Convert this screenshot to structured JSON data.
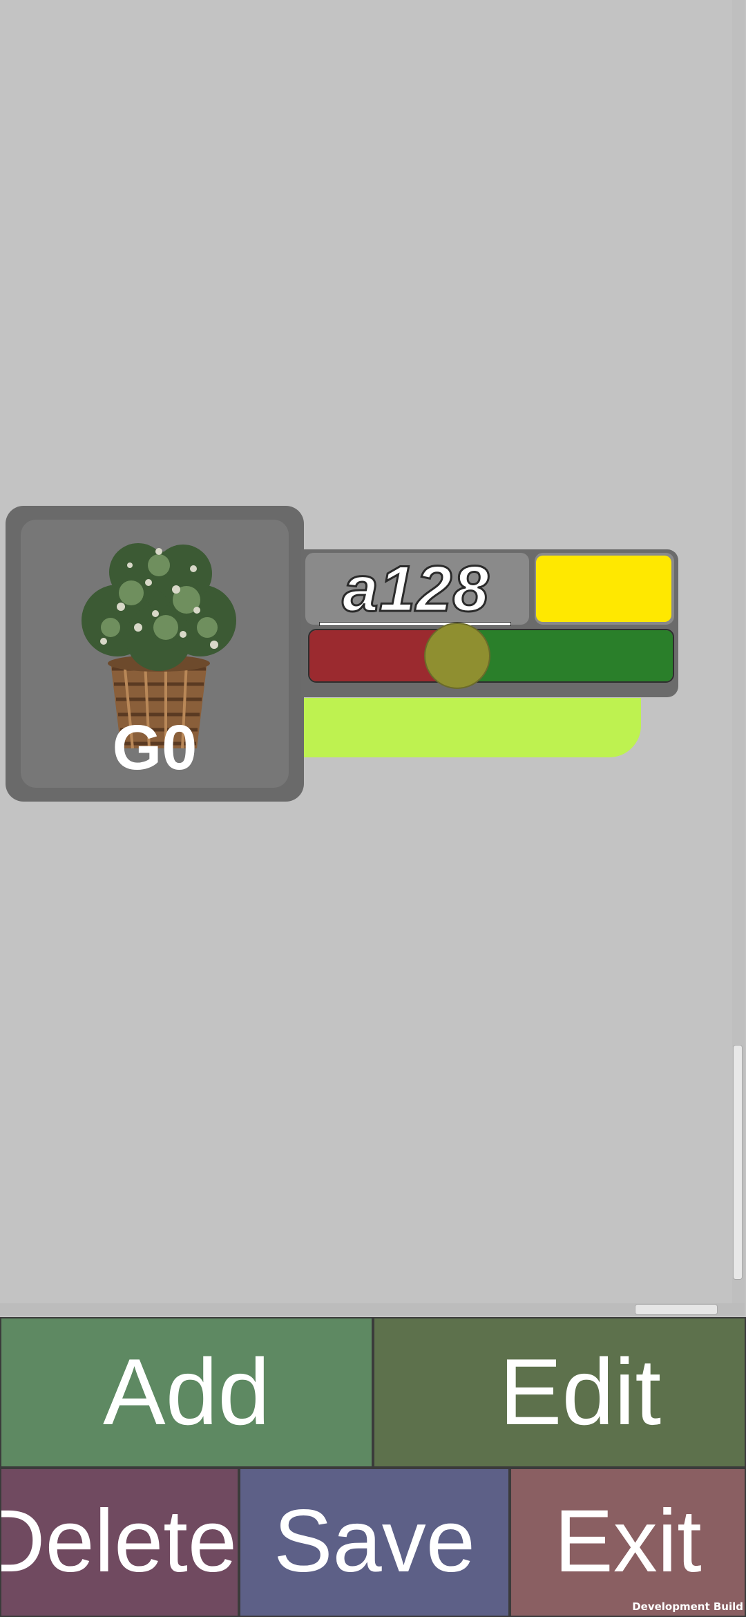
{
  "item": {
    "label": "G0",
    "name": "a128",
    "image_icon": "potted-plant-icon",
    "swatch_color": "#ffe800",
    "slider_value": 0.4
  },
  "buttons": {
    "add": "Add",
    "edit": "Edit",
    "delete": "Delete",
    "save": "Save",
    "exit": "Exit"
  },
  "footer": {
    "dev_build": "Development Build"
  },
  "colors": {
    "background": "#c3c3c3",
    "slider_left": "#9b2a2f",
    "slider_right": "#2a7f2a",
    "lime_bar": "#bef250"
  }
}
